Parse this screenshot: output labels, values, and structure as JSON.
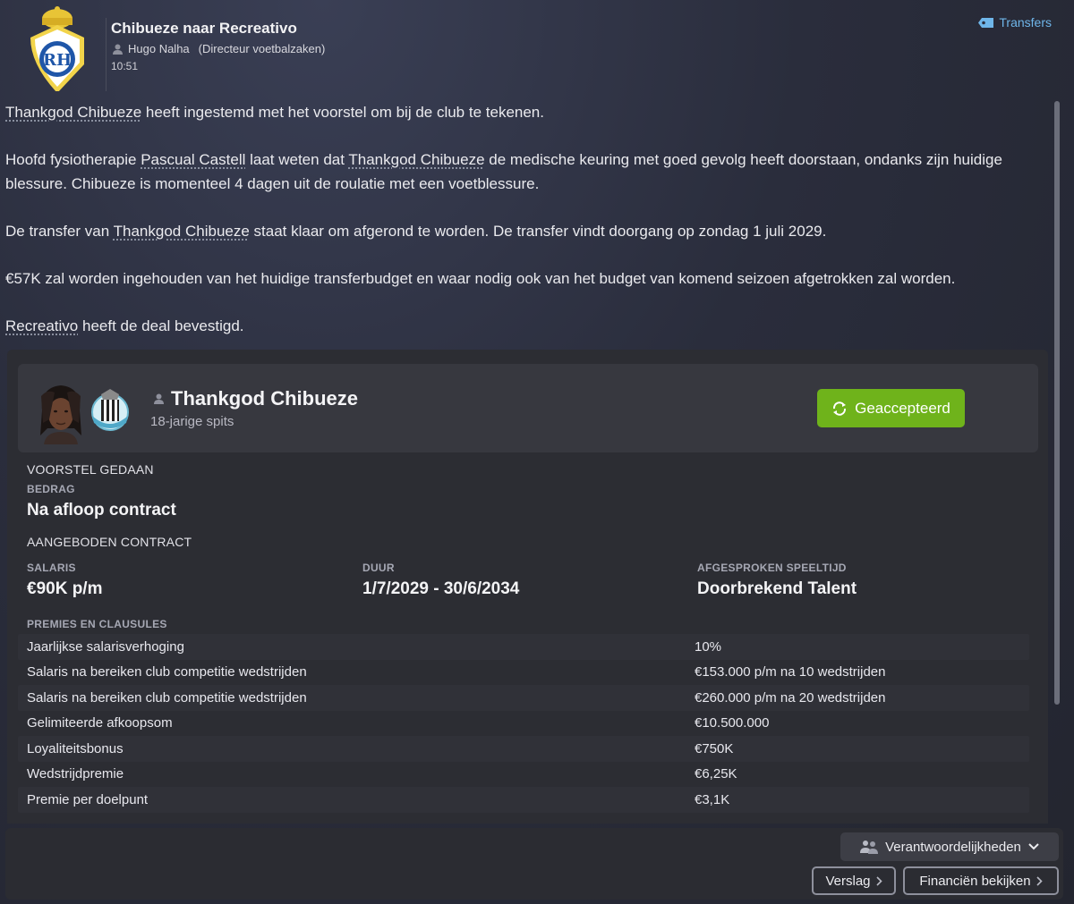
{
  "header": {
    "subject": "Chibueze naar Recreativo",
    "sender_name": "Hugo Nalha",
    "sender_role": "(Directeur voetbalzaken)",
    "time": "10:51",
    "transfers_link": "Transfers",
    "accent_color": "#6fb6ea"
  },
  "message": {
    "p1_link": "Thankgod Chibueze",
    "p1_rest": " heeft ingestemd met het voorstel om bij de club te tekenen.",
    "p2_a": "Hoofd fysiotherapie ",
    "p2_link1": "Pascual Castell",
    "p2_b": " laat weten dat ",
    "p2_link2": "Thankgod Chibueze",
    "p2_c": " de medische keuring met goed gevolg heeft doorstaan, ondanks zijn huidige blessure. Chibueze is momenteel 4 dagen uit de roulatie met een voetblessure.",
    "p3_a": "De transfer van ",
    "p3_link": "Thankgod Chibueze",
    "p3_b": " staat klaar om afgerond te worden. De transfer vindt doorgang op zondag 1 juli 2029.",
    "p4": "€57K zal worden ingehouden van het huidige transferbudget en waar nodig ook van het budget van komend seizoen afgetrokken zal worden.",
    "p5_link": "Recreativo",
    "p5_rest": " heeft de deal bevestigd."
  },
  "player": {
    "name": "Thankgod Chibueze",
    "description": "18-jarige spits",
    "status_button": "Geaccepteerd",
    "status_color": "#6fb31b"
  },
  "offer": {
    "section_title": "VOORSTEL GEDAAN",
    "amount_label": "BEDRAG",
    "amount_value": "Na afloop contract",
    "contract_title": "AANGEBODEN CONTRACT",
    "salary_label": "SALARIS",
    "salary_value": "€90K p/m",
    "duration_label": "DUUR",
    "duration_value": "1/7/2029 - 30/6/2034",
    "playtime_label": "AFGESPROKEN SPEELTIJD",
    "playtime_value": "Doorbrekend Talent",
    "clauses_title": "PREMIES EN CLAUSULES",
    "clauses": [
      {
        "name": "Jaarlijkse salarisverhoging",
        "value": "10%"
      },
      {
        "name": "Salaris na bereiken club competitie wedstrijden",
        "value": "€153.000 p/m na 10 wedstrijden"
      },
      {
        "name": "Salaris na bereiken club competitie wedstrijden",
        "value": "€260.000 p/m na 20 wedstrijden"
      },
      {
        "name": "Gelimiteerde afkoopsom",
        "value": "€10.500.000"
      },
      {
        "name": "Loyaliteitsbonus",
        "value": "€750K"
      },
      {
        "name": "Wedstrijdpremie",
        "value": "€6,25K"
      },
      {
        "name": "Premie per doelpunt",
        "value": "€3,1K"
      }
    ]
  },
  "footer": {
    "responsibilities": "Verantwoordelijkheden",
    "report": "Verslag",
    "finances": "Financiën bekijken"
  }
}
